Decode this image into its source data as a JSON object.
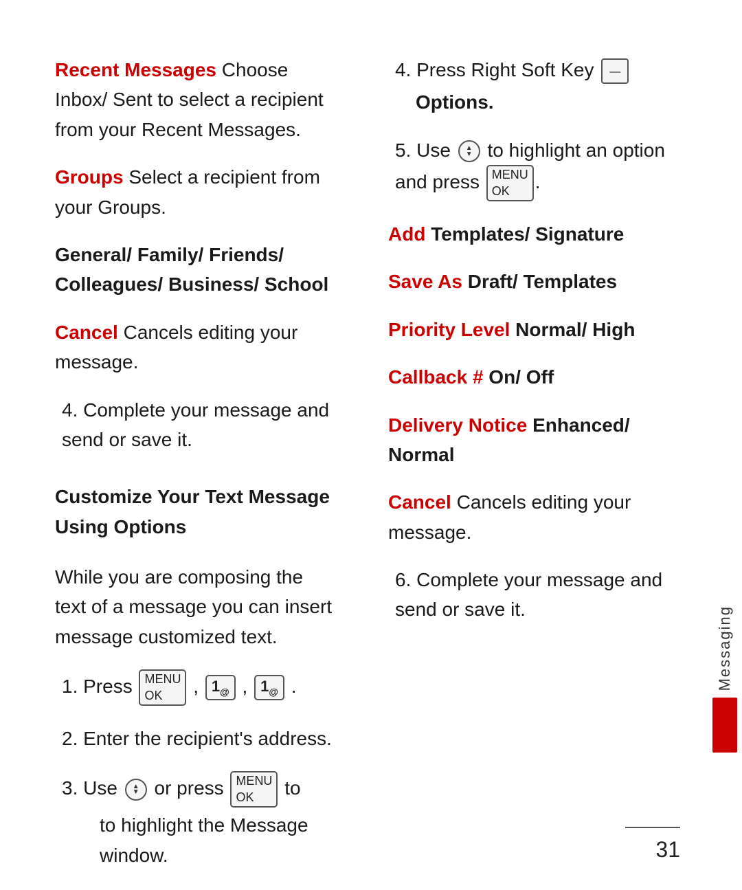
{
  "left": {
    "recent_messages_label": "Recent Messages",
    "recent_messages_text": " Choose Inbox/ Sent to select a recipient from your Recent Messages.",
    "groups_label": "Groups",
    "groups_text": " Select a recipient from your Groups.",
    "general_family": "General/ Family/ Friends/ Colleagues/ Business/ School",
    "cancel_label": "Cancel",
    "cancel_text": "  Cancels editing your message.",
    "step4_text": "4. Complete your message and send or save it.",
    "customize_heading": "Customize Your Text Message Using Options",
    "while_text": "While you are composing the text of a message you can insert message customized text.",
    "step1_text": "1. Press",
    "step1_keys": "MENU OK , 1 , 1",
    "step2_text": "2. Enter the recipient's address.",
    "step3_text": "3. Use",
    "step3_or": "or press",
    "step3_to": "to highlight the Message window."
  },
  "right": {
    "step4_text": "4. Press Right Soft Key",
    "step4_options": "Options.",
    "step5_text": "5. Use",
    "step5_to": "to highlight an option and press",
    "step5_end": ".",
    "add_label": "Add",
    "add_text": " Templates/ Signature",
    "save_as_label": "Save As",
    "save_as_text": " Draft/ Templates",
    "priority_label": "Priority Level",
    "priority_text": " Normal/ High",
    "callback_label": "Callback #",
    "callback_text": " On/ Off",
    "delivery_label": "Delivery Notice",
    "delivery_text": " Enhanced/ Normal",
    "cancel_label": "Cancel",
    "cancel_text": " Cancels editing your message.",
    "step6_text": "6. Complete your message and send or save it."
  },
  "sidebar": {
    "label": "Messaging"
  },
  "page_number": "31"
}
